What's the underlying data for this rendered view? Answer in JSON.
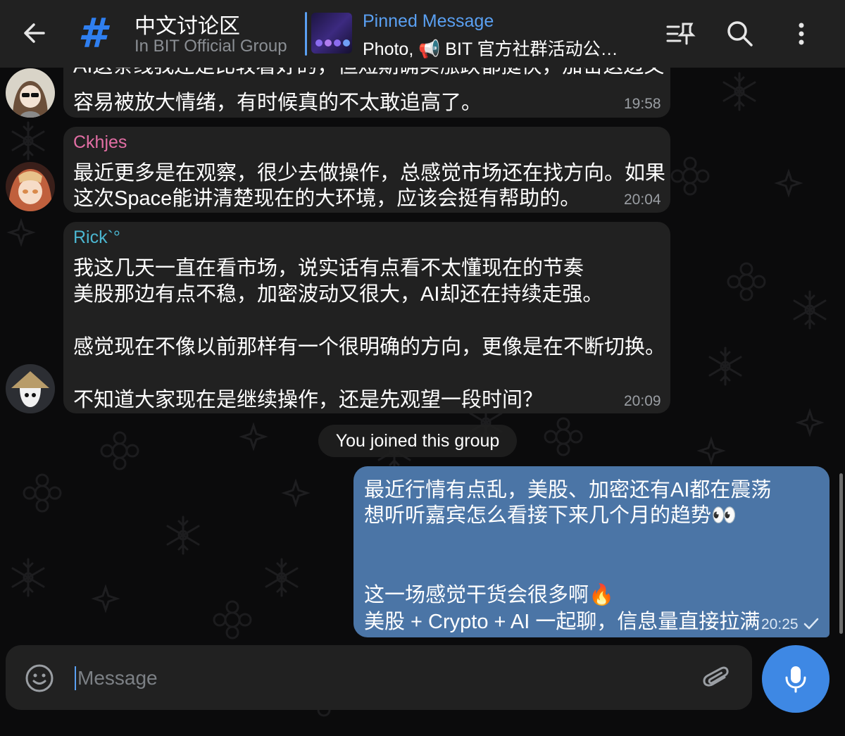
{
  "header": {
    "title": "中文讨论区",
    "subtitle": "In BIT Official Group",
    "group_avatar_glyph": "#",
    "pinned_title": "Pinned Message",
    "pinned_text": "Photo, 📢 BIT 官方社群活动公…",
    "icons": [
      "back-arrow-icon",
      "pin-list-icon",
      "search-icon",
      "more-vertical-icon"
    ]
  },
  "messages": [
    {
      "sender": "",
      "lines": [
        "AI这条线我还是比较看好的，但短期确实涨跌都挺快，加密这边又",
        "容易被放大情绪，有时候真的不太敢追高了。"
      ],
      "time": "19:58"
    },
    {
      "sender": "Ckhjes",
      "sender_color": "#e26ea4",
      "lines": [
        "最近更多是在观察，很少去做操作，总感觉市场还在找方向。如果",
        "这次Space能讲清楚现在的大环境，应该会挺有帮助的。"
      ],
      "time": "20:04"
    },
    {
      "sender": "Rick`°",
      "sender_color": "#4bb6d0",
      "lines": [
        "我这几天一直在看市场，说实话有点看不太懂现在的节奏",
        "美股那边有点不稳，加密波动又很大，AI却还在持续走强。",
        "",
        "感觉现在不像以前那样有一个很明确的方向，更像是在不断切换。",
        "",
        "不知道大家现在是继续操作，还是先观望一段时间？"
      ],
      "time": "20:09"
    }
  ],
  "service_message": "You joined this group",
  "own_message": {
    "lines": [
      "最近行情有点乱，美股、加密还有AI都在震荡",
      "想听听嘉宾怎么看接下来几个月的趋势👀",
      "",
      "",
      "这一场感觉干货会很多啊🔥",
      "美股 + Crypto + AI 一起聊，信息量直接拉满"
    ],
    "time": "20:25",
    "status": "sent-check-icon"
  },
  "composer": {
    "placeholder": "Message",
    "icons": [
      "emoji-icon",
      "attach-icon",
      "microphone-icon"
    ]
  },
  "colors": {
    "header_bg": "#212121",
    "bubble_bg": "#212121",
    "own_bubble_bg": "#4b75a6",
    "accent": "#3e88e4",
    "link_blue": "#5aa0f2"
  }
}
